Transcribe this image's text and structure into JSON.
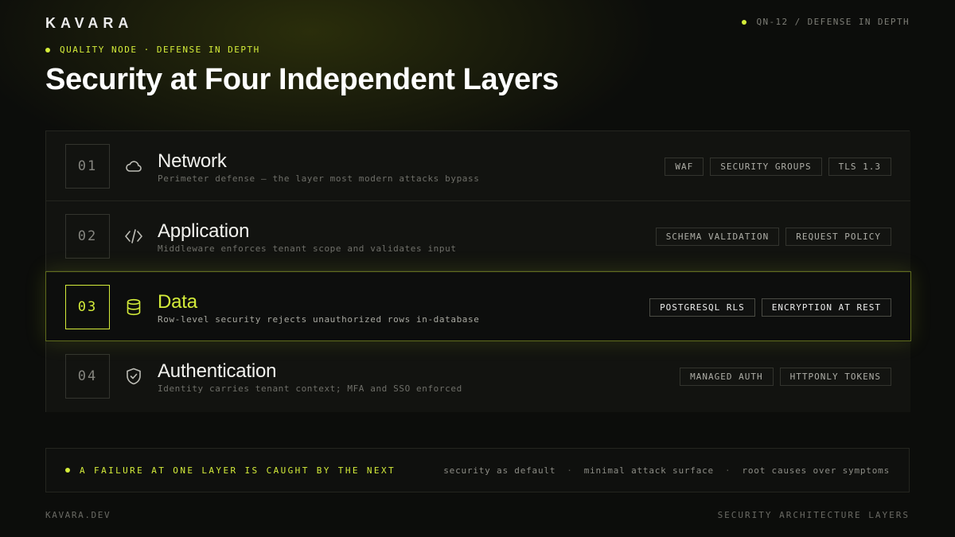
{
  "brand": "KAVARA",
  "header": {
    "ref": "QN-12 / DEFENSE IN DEPTH",
    "eyebrow": "QUALITY NODE · DEFENSE IN DEPTH",
    "title": "Security at Four Independent Layers"
  },
  "colors": {
    "accent": "#d4ec3a",
    "background": "#0c0d0b"
  },
  "layers": [
    {
      "num": "01",
      "icon": "cloud-icon",
      "name": "Network",
      "desc": "Perimeter defense — the layer most modern attacks bypass",
      "tags": [
        "WAF",
        "SECURITY GROUPS",
        "TLS 1.3"
      ],
      "active": false
    },
    {
      "num": "02",
      "icon": "code-icon",
      "name": "Application",
      "desc": "Middleware enforces tenant scope and validates input",
      "tags": [
        "SCHEMA VALIDATION",
        "REQUEST POLICY"
      ],
      "active": false
    },
    {
      "num": "03",
      "icon": "database-icon",
      "name": "Data",
      "desc": "Row-level security rejects unauthorized rows in-database",
      "tags": [
        "POSTGRESQL RLS",
        "ENCRYPTION AT REST"
      ],
      "active": true
    },
    {
      "num": "04",
      "icon": "shield-check-icon",
      "name": "Authentication",
      "desc": "Identity carries tenant context; MFA and SSO enforced",
      "tags": [
        "MANAGED AUTH",
        "HTTPONLY TOKENS"
      ],
      "active": false
    }
  ],
  "summary": {
    "statement": "A FAILURE AT ONE LAYER IS CAUGHT BY THE NEXT",
    "principles": [
      "security as default",
      "minimal attack surface",
      "root causes over symptoms"
    ],
    "separator": "·"
  },
  "footer": {
    "left": "KAVARA.DEV",
    "right": "SECURITY ARCHITECTURE LAYERS"
  }
}
